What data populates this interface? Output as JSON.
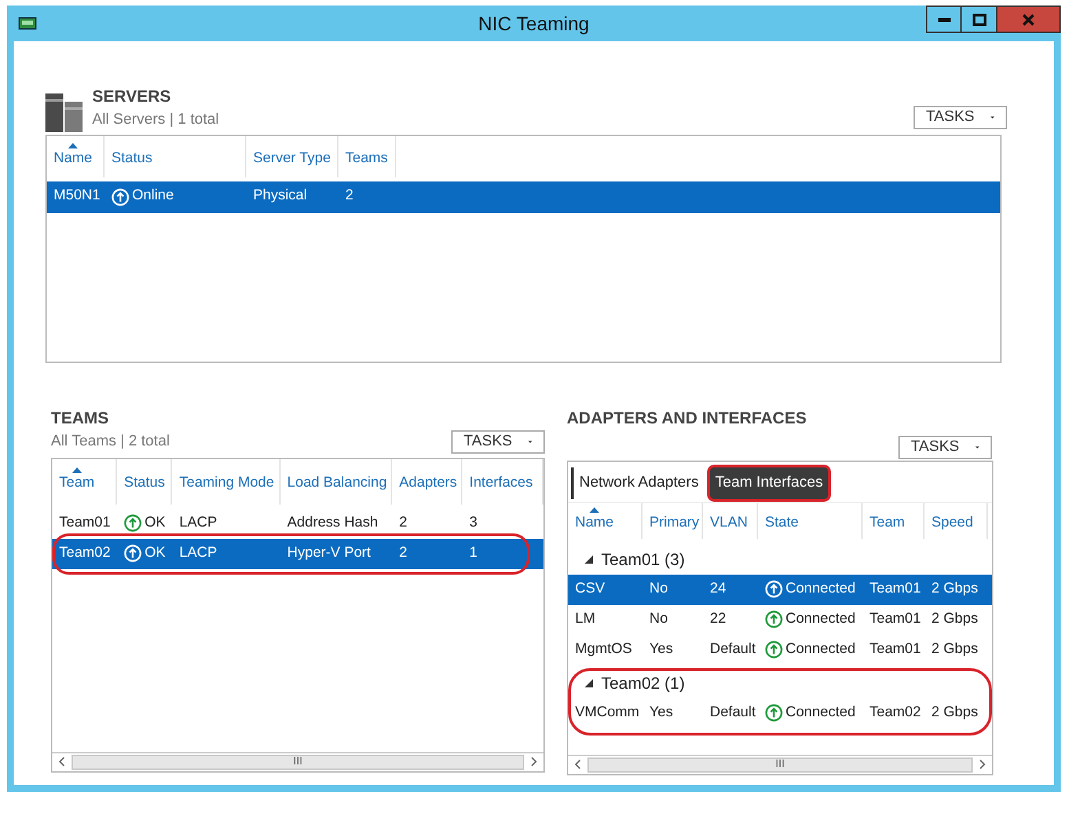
{
  "window": {
    "title": "NIC Teaming"
  },
  "servers": {
    "title": "SERVERS",
    "subtitle": "All Servers | 1 total",
    "tasks": "TASKS",
    "columns": [
      "Name",
      "Status",
      "Server Type",
      "Teams"
    ],
    "rows": [
      {
        "selected": true,
        "cells": [
          "M50N1",
          "Online",
          "Physical",
          "2"
        ]
      }
    ]
  },
  "teams": {
    "title": "TEAMS",
    "subtitle": "All Teams | 2 total",
    "tasks": "TASKS",
    "columns": [
      "Team",
      "Status",
      "Teaming Mode",
      "Load Balancing",
      "Adapters",
      "Interfaces"
    ],
    "rows": [
      {
        "selected": false,
        "circled": false,
        "cells": [
          "Team01",
          "OK",
          "LACP",
          "Address Hash",
          "2",
          "3"
        ]
      },
      {
        "selected": true,
        "circled": true,
        "cells": [
          "Team02",
          "OK",
          "LACP",
          "Hyper-V Port",
          "2",
          "1"
        ]
      }
    ],
    "scroll_thumb": "III"
  },
  "adapters": {
    "title": "ADAPTERS AND INTERFACES",
    "tasks": "TASKS",
    "tabs": [
      {
        "label": "Network Adapters",
        "selected": false,
        "circled": false
      },
      {
        "label": "Team Interfaces",
        "selected": true,
        "circled": true
      }
    ],
    "columns": [
      "Name",
      "Primary",
      "VLAN",
      "State",
      "Team",
      "Speed"
    ],
    "groups": [
      {
        "label": "Team01 (3)",
        "expanded": true,
        "circled": false,
        "rows": [
          {
            "selected": true,
            "cells": [
              "CSV",
              "No",
              "24",
              "Connected",
              "Team01",
              "2 Gbps"
            ]
          },
          {
            "selected": false,
            "cells": [
              "LM",
              "No",
              "22",
              "Connected",
              "Team01",
              "2 Gbps"
            ]
          },
          {
            "selected": false,
            "cells": [
              "MgmtOS",
              "Yes",
              "Default",
              "Connected",
              "Team01",
              "2 Gbps"
            ]
          }
        ]
      },
      {
        "label": "Team02 (1)",
        "expanded": true,
        "circled": true,
        "rows": [
          {
            "selected": false,
            "cells": [
              "VMComm",
              "Yes",
              "Default",
              "Connected",
              "Team02",
              "2 Gbps"
            ]
          }
        ]
      }
    ],
    "scroll_thumb": "III"
  }
}
